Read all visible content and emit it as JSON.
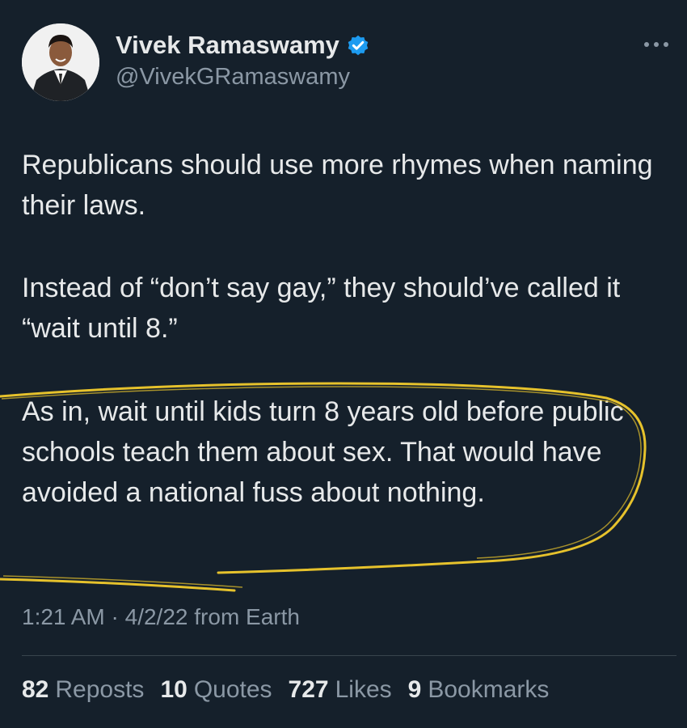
{
  "author": {
    "display_name": "Vivek Ramaswamy",
    "handle": "@VivekGRamaswamy",
    "verified_color": "#1d9bf0"
  },
  "tweet": {
    "paragraphs": [
      "Republicans should use more rhymes when naming their laws.",
      "Instead of “don’t say gay,” they should’ve called it “wait until 8.”",
      "As in, wait until kids turn 8 years old before public schools teach them about sex. That would have avoided a national fuss about nothing."
    ],
    "time": "1:21 AM",
    "separator": "·",
    "date": "4/2/22",
    "source": "from Earth"
  },
  "stats": [
    {
      "count": "82",
      "label": "Reposts"
    },
    {
      "count": "10",
      "label": "Quotes"
    },
    {
      "count": "727",
      "label": "Likes"
    },
    {
      "count": "9",
      "label": "Bookmarks"
    }
  ],
  "colors": {
    "background": "#15202b",
    "highlight": "#e6c22c",
    "secondary_text": "#8b98a5"
  },
  "icons": {
    "more": "more-horizontal-icon",
    "verified": "verified-badge-icon"
  }
}
